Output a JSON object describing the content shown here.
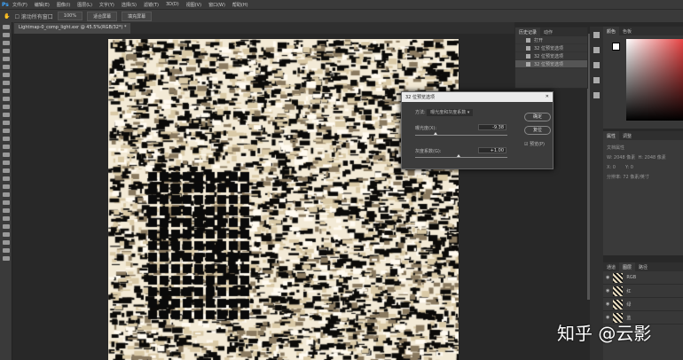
{
  "app": {
    "logo": "Ps"
  },
  "menu": [
    "文件(F)",
    "编辑(E)",
    "图像(I)",
    "图层(L)",
    "文字(Y)",
    "选择(S)",
    "滤镜(T)",
    "3D(D)",
    "视图(V)",
    "窗口(W)",
    "帮助(H)"
  ],
  "options": {
    "scroll_all": "滚动所有窗口",
    "zoom": "100%",
    "fit": "适合屏幕",
    "fill": "填充屏幕"
  },
  "document_tab": "Lightmap-0_comp_light.exr @ 45.5%(RGB/32*) *",
  "history": {
    "tabs": [
      "历史记录",
      "动作"
    ],
    "items": [
      "打开",
      "32 位预览选项",
      "32 位预览选项",
      "32 位预览选项"
    ]
  },
  "color": {
    "tabs": [
      "颜色",
      "色板"
    ]
  },
  "properties": {
    "tabs": [
      "属性",
      "调整"
    ],
    "doc": "文档属性",
    "w": "W: 2048 像素",
    "h": "H: 2048 像素",
    "x": "X: 0",
    "y": "Y: 0",
    "res": "分辨率: 72 像素/英寸"
  },
  "layers": {
    "tabs": [
      "通道",
      "图层",
      "路径"
    ],
    "items": [
      "RGB",
      "红",
      "绿",
      "蓝"
    ]
  },
  "dialog": {
    "title": "32 位预览选项",
    "method_label": "方法:",
    "method_value": "曝光度和灰度系数",
    "exposure_label": "曝光度(X):",
    "exposure_value": "-9.38",
    "exposure_fraction": 0.2,
    "gamma_label": "灰度系数(G):",
    "gamma_value": "+1.00",
    "gamma_fraction": 0.45,
    "ok": "确定",
    "reset": "复位",
    "preview": "预览(P)"
  },
  "watermark": "知乎 @云影"
}
